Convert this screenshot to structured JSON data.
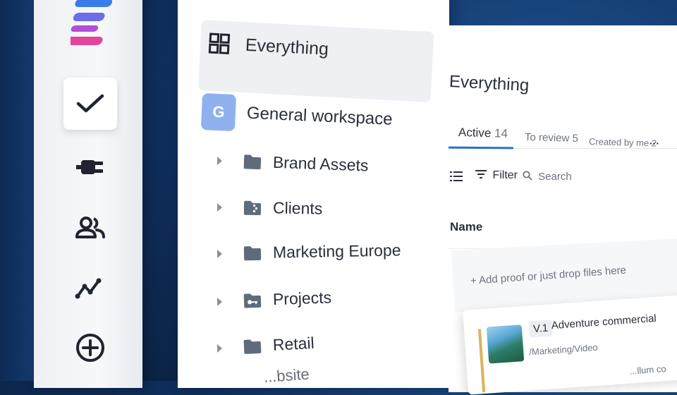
{
  "rail": {
    "items": [
      {
        "name": "checkmark-icon",
        "active": true
      },
      {
        "name": "plug-icon"
      },
      {
        "name": "users-icon"
      },
      {
        "name": "analytics-icon"
      },
      {
        "name": "add-circle-icon"
      }
    ]
  },
  "tree": {
    "everything_label": "Everything",
    "workspace": {
      "initial": "G",
      "label": "General workspace"
    },
    "folders": [
      {
        "label": "Brand Assets",
        "icon": "folder-icon"
      },
      {
        "label": "Clients",
        "icon": "zip-folder-icon"
      },
      {
        "label": "Marketing Europe",
        "icon": "folder-icon"
      },
      {
        "label": "Projects",
        "icon": "locked-folder-icon"
      },
      {
        "label": "Retail",
        "icon": "folder-icon"
      },
      {
        "label": "...bsite",
        "icon": "folder-icon"
      }
    ]
  },
  "content": {
    "title": "Everything",
    "tabs": [
      {
        "label": "Active",
        "count": "14"
      },
      {
        "label": "To review",
        "count": "5"
      },
      {
        "label": "Created by me",
        "count": "2"
      }
    ],
    "more_label": "···",
    "toolbar": {
      "filter_label": "Filter",
      "search_placeholder": "Search"
    },
    "column_header": "Name",
    "add_proof_text": "+ Add proof or just drop files here",
    "card": {
      "version": "V.1",
      "title": "Adventure commercial",
      "path": "/Marketing/Video",
      "overflow_text": "...llum co"
    }
  },
  "colors": {
    "accent": "#2d6fd6",
    "workspace_badge": "#8fb2ee",
    "card_bar": "#d9b45b"
  }
}
